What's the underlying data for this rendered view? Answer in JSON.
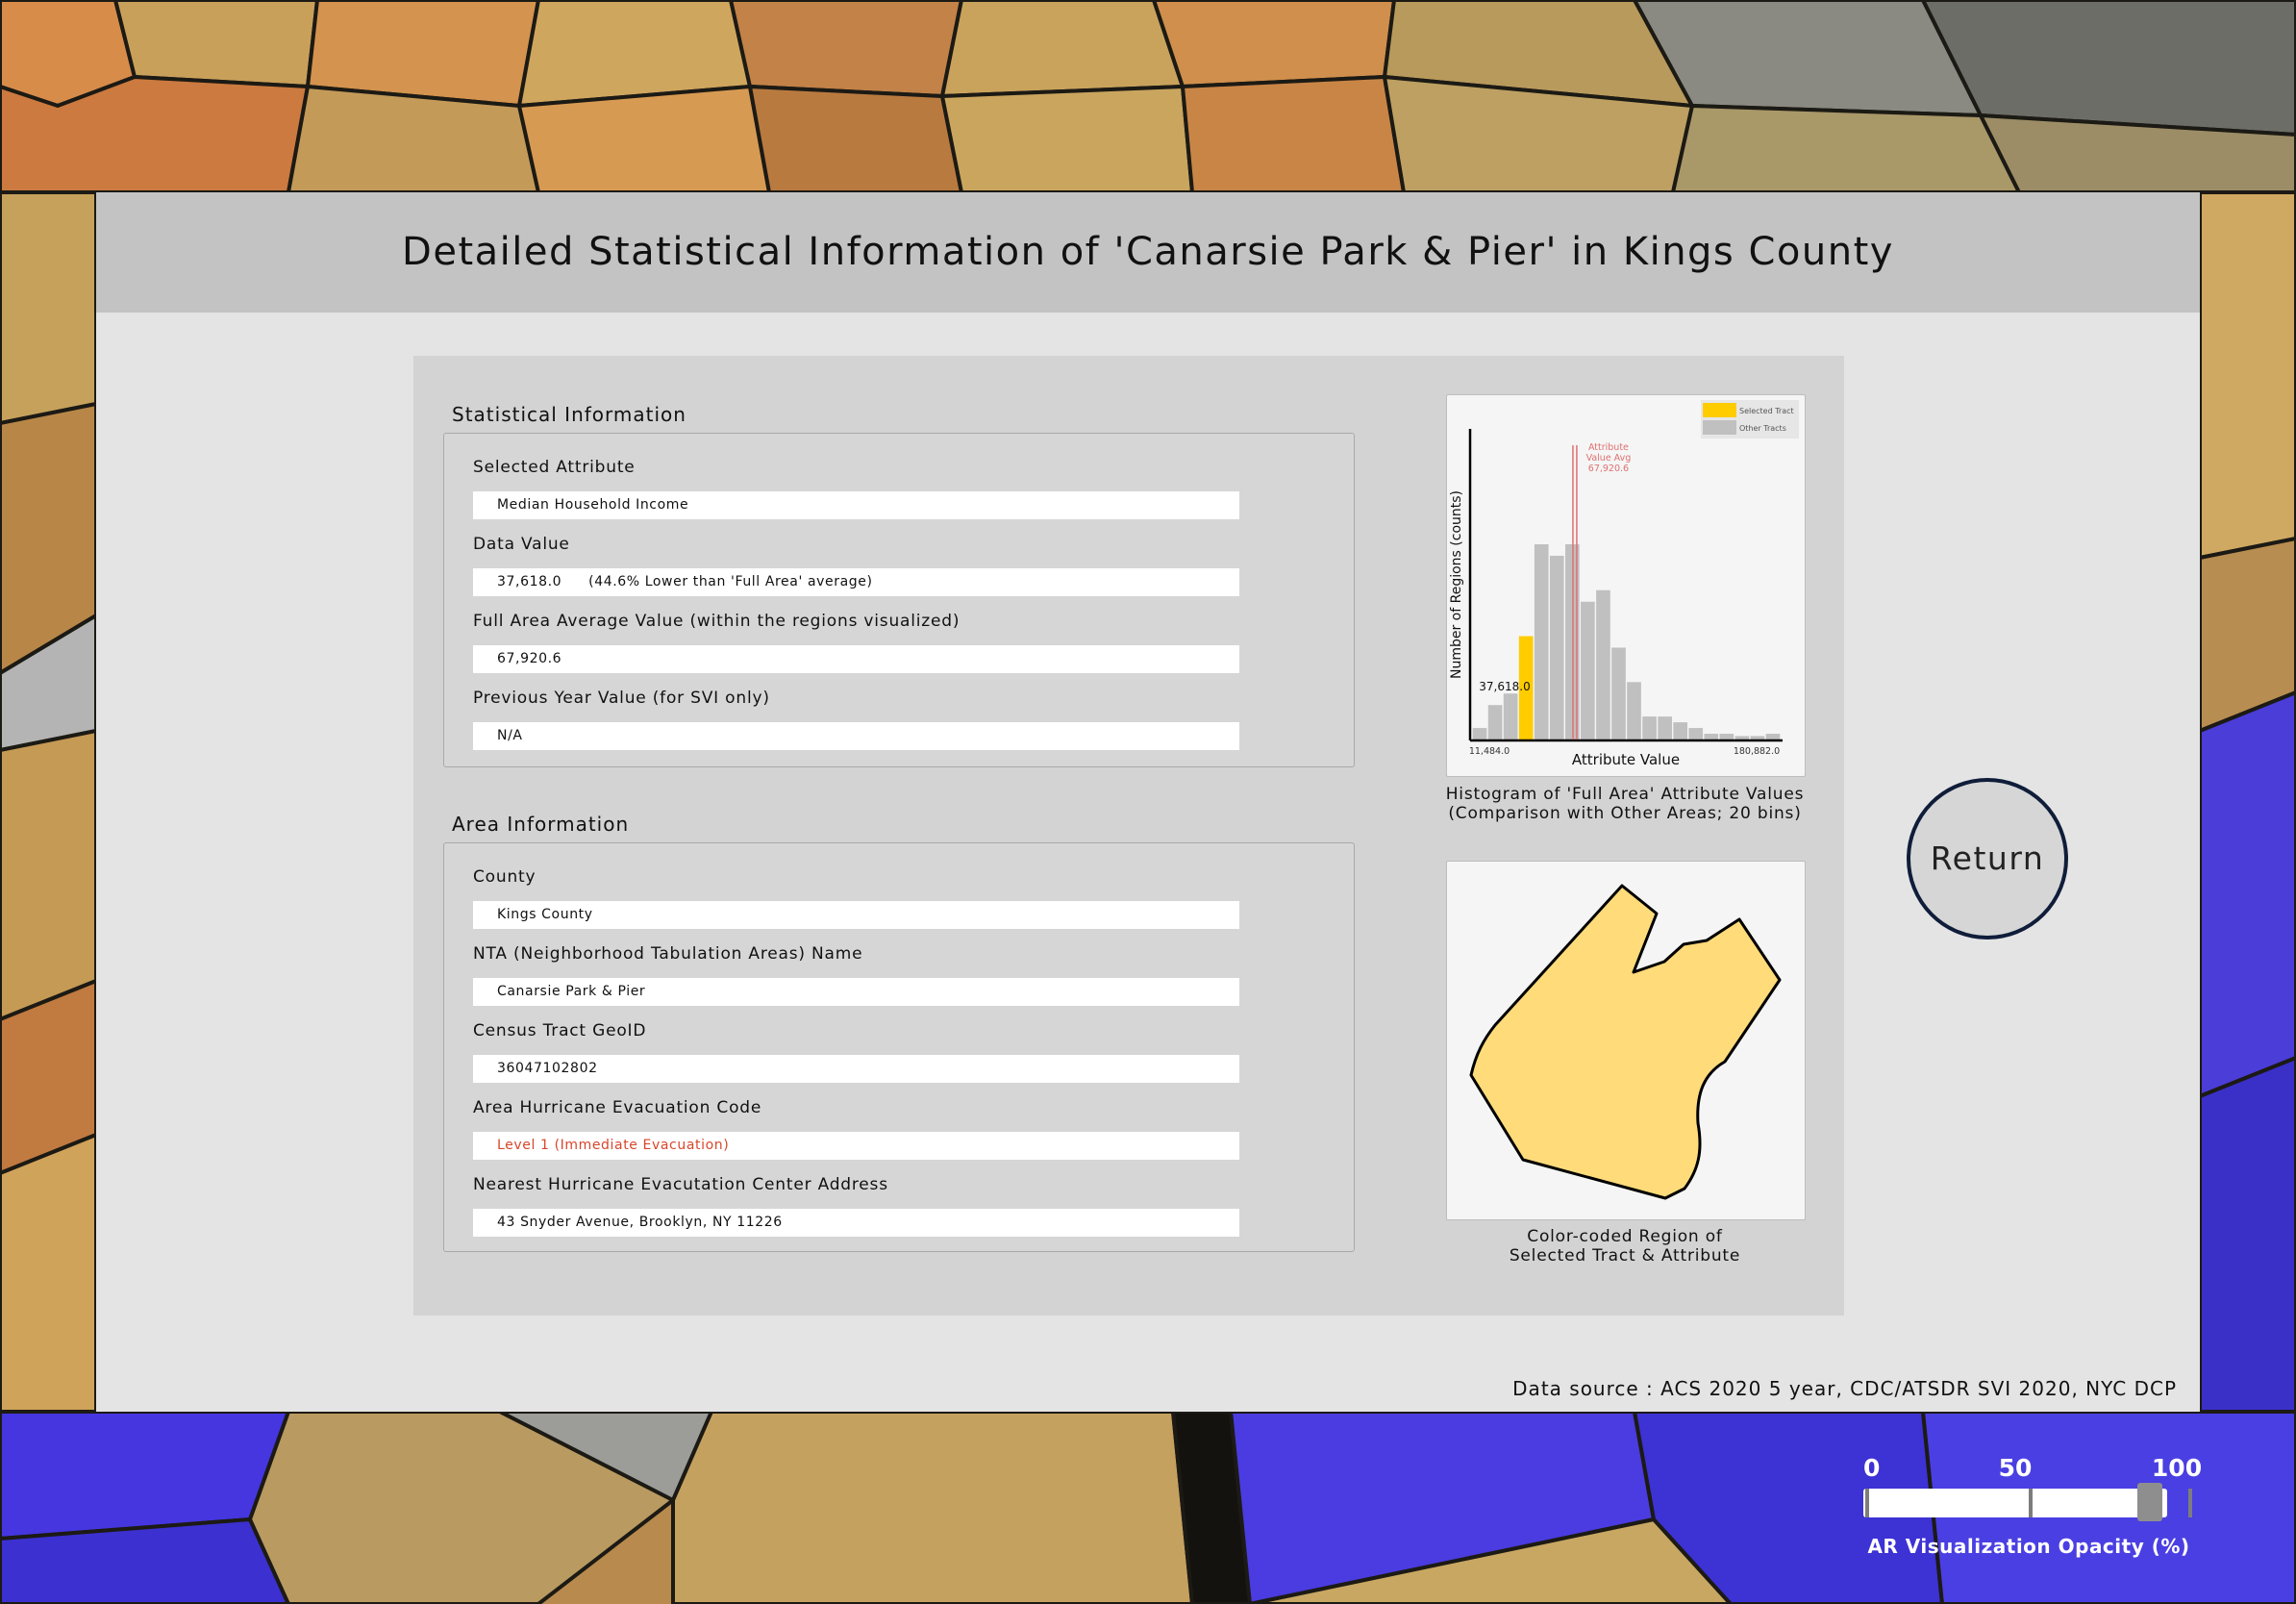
{
  "modal": {
    "title": "Detailed Statistical Information of 'Canarsie Park & Pier' in Kings County",
    "data_source": "Data source : ACS 2020 5 year, CDC/ATSDR SVI 2020, NYC DCP",
    "return_label": "Return"
  },
  "statistical_info": {
    "section_title": "Statistical Information",
    "fields": [
      {
        "label": "Selected Attribute",
        "value": "Median Household Income"
      },
      {
        "label": "Data Value",
        "value": "37,618.0",
        "note": "(44.6% Lower than 'Full Area' average)"
      },
      {
        "label": "Full Area Average Value (within the regions visualized)",
        "value": "67,920.6"
      },
      {
        "label": "Previous Year Value (for SVI only)",
        "value": "N/A"
      }
    ]
  },
  "area_info": {
    "section_title": "Area Information",
    "fields": [
      {
        "label": "County",
        "value": "Kings County"
      },
      {
        "label": "NTA (Neighborhood Tabulation Areas) Name",
        "value": "Canarsie Park & Pier"
      },
      {
        "label": "Census Tract GeoID",
        "value": "36047102802"
      },
      {
        "label": "Area Hurricane Evacuation Code",
        "value": "Level 1 (Immediate Evacuation)",
        "status_color": "#d8462c"
      },
      {
        "label": "Nearest Hurricane Evacutation Center Address",
        "value": "43 Snyder Avenue, Brooklyn, NY 11226"
      }
    ]
  },
  "histogram": {
    "caption_line1": "Histogram of 'Full Area' Attribute Values",
    "caption_line2": "(Comparison with Other Areas; 20 bins)",
    "selected_label": "37,618.0",
    "avg_label_line1": "Attribute",
    "avg_label_line2": "Value Avg",
    "avg_label_line3": "67,920.6"
  },
  "chart_data": {
    "type": "bar",
    "xlabel": "Attribute Value",
    "ylabel": "Number of Regions (counts)",
    "x_min_label": "11,484.0",
    "x_max_label": "180,882.0",
    "xlim": [
      11484.0,
      180882.0
    ],
    "bins": 20,
    "values": [
      1,
      3,
      4,
      9,
      17,
      16,
      17,
      12,
      13,
      8,
      5,
      2,
      2,
      1.5,
      1,
      0.5,
      0.5,
      0.3,
      0.3,
      0.5
    ],
    "selected_bin": 3,
    "selected_value": 37618.0,
    "average_value": 67920.6,
    "legend": [
      {
        "name": "Selected Tract",
        "color": "#ffcc00"
      },
      {
        "name": "Other Tracts",
        "color": "#c0c0c0"
      }
    ],
    "legend_position": "top-right",
    "avg_line_color": "#e07070"
  },
  "region": {
    "caption_line1": "Color-coded Region of",
    "caption_line2": "Selected Tract & Attribute",
    "fill_color": "#ffdb7a"
  },
  "opacity_slider": {
    "tick_0": "0",
    "tick_50": "50",
    "tick_100": "100",
    "caption": "AR Visualization Opacity (%)",
    "value_percent": 88
  }
}
